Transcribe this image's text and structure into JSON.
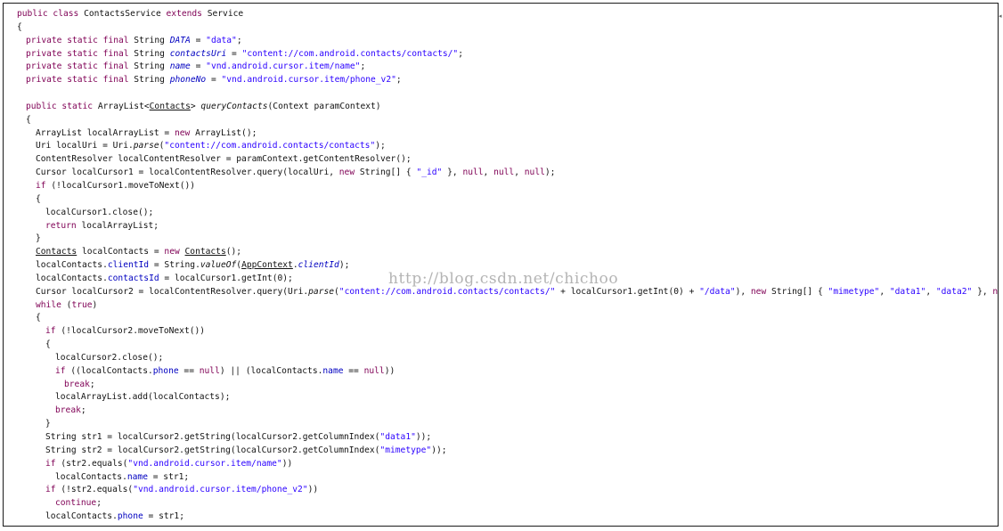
{
  "watermark": "http://blog.csdn.net/chichoo",
  "scroll_marker": "◂",
  "colors": {
    "keyword": "#7f0055",
    "string": "#2a00ff",
    "field": "#0000c0",
    "text": "#111111"
  },
  "lines": [
    {
      "indent": 0,
      "tokens": [
        {
          "t": "public class ",
          "c": "kw"
        },
        {
          "t": "ContactsService "
        },
        {
          "t": "extends ",
          "c": "kw"
        },
        {
          "t": "Service"
        }
      ]
    },
    {
      "indent": 0,
      "tokens": [
        {
          "t": "{"
        }
      ]
    },
    {
      "indent": 1,
      "tokens": [
        {
          "t": "private static final ",
          "c": "kw"
        },
        {
          "t": "String "
        },
        {
          "t": "DATA",
          "c": "fld it"
        },
        {
          "t": " = "
        },
        {
          "t": "\"data\"",
          "c": "st"
        },
        {
          "t": ";"
        }
      ]
    },
    {
      "indent": 1,
      "tokens": [
        {
          "t": "private static final ",
          "c": "kw"
        },
        {
          "t": "String "
        },
        {
          "t": "contactsUri",
          "c": "fld it"
        },
        {
          "t": " = "
        },
        {
          "t": "\"content://com.android.contacts/contacts/\"",
          "c": "st"
        },
        {
          "t": ";"
        }
      ]
    },
    {
      "indent": 1,
      "tokens": [
        {
          "t": "private static final ",
          "c": "kw"
        },
        {
          "t": "String "
        },
        {
          "t": "name",
          "c": "fld it"
        },
        {
          "t": " = "
        },
        {
          "t": "\"vnd.android.cursor.item/name\"",
          "c": "st"
        },
        {
          "t": ";"
        }
      ]
    },
    {
      "indent": 1,
      "tokens": [
        {
          "t": "private static final ",
          "c": "kw"
        },
        {
          "t": "String "
        },
        {
          "t": "phoneNo",
          "c": "fld it"
        },
        {
          "t": " = "
        },
        {
          "t": "\"vnd.android.cursor.item/phone_v2\"",
          "c": "st"
        },
        {
          "t": ";"
        }
      ]
    },
    {
      "indent": 0,
      "tokens": []
    },
    {
      "indent": 1,
      "tokens": [
        {
          "t": "public static ",
          "c": "kw"
        },
        {
          "t": "ArrayList<"
        },
        {
          "t": "Contacts",
          "c": "u"
        },
        {
          "t": "> "
        },
        {
          "t": "queryContacts",
          "c": "it"
        },
        {
          "t": "(Context paramContext)"
        }
      ]
    },
    {
      "indent": 1,
      "tokens": [
        {
          "t": "{"
        }
      ]
    },
    {
      "indent": 2,
      "tokens": [
        {
          "t": "ArrayList localArrayList = "
        },
        {
          "t": "new ",
          "c": "kw"
        },
        {
          "t": "ArrayList();"
        }
      ]
    },
    {
      "indent": 2,
      "tokens": [
        {
          "t": "Uri localUri = Uri."
        },
        {
          "t": "parse",
          "c": "it"
        },
        {
          "t": "("
        },
        {
          "t": "\"content://com.android.contacts/contacts\"",
          "c": "st"
        },
        {
          "t": ");"
        }
      ]
    },
    {
      "indent": 2,
      "tokens": [
        {
          "t": "ContentResolver localContentResolver = paramContext.getContentResolver();"
        }
      ]
    },
    {
      "indent": 2,
      "tokens": [
        {
          "t": "Cursor localCursor1 = localContentResolver.query(localUri, "
        },
        {
          "t": "new ",
          "c": "kw"
        },
        {
          "t": "String[] { "
        },
        {
          "t": "\"_id\"",
          "c": "st"
        },
        {
          "t": " }, "
        },
        {
          "t": "null",
          "c": "kw"
        },
        {
          "t": ", "
        },
        {
          "t": "null",
          "c": "kw"
        },
        {
          "t": ", "
        },
        {
          "t": "null",
          "c": "kw"
        },
        {
          "t": ");"
        }
      ]
    },
    {
      "indent": 2,
      "tokens": [
        {
          "t": "if ",
          "c": "kw"
        },
        {
          "t": "(!localCursor1.moveToNext())"
        }
      ]
    },
    {
      "indent": 2,
      "tokens": [
        {
          "t": "{"
        }
      ]
    },
    {
      "indent": 3,
      "tokens": [
        {
          "t": "localCursor1.close();"
        }
      ]
    },
    {
      "indent": 3,
      "tokens": [
        {
          "t": "return ",
          "c": "kw"
        },
        {
          "t": "localArrayList;"
        }
      ]
    },
    {
      "indent": 2,
      "tokens": [
        {
          "t": "}"
        }
      ]
    },
    {
      "indent": 2,
      "tokens": [
        {
          "t": "Contacts",
          "c": "u"
        },
        {
          "t": " localContacts = "
        },
        {
          "t": "new ",
          "c": "kw"
        },
        {
          "t": "Contacts",
          "c": "u"
        },
        {
          "t": "();"
        }
      ]
    },
    {
      "indent": 2,
      "tokens": [
        {
          "t": "localContacts."
        },
        {
          "t": "clientId",
          "c": "fld"
        },
        {
          "t": " = String."
        },
        {
          "t": "valueOf",
          "c": "it"
        },
        {
          "t": "("
        },
        {
          "t": "AppContext",
          "c": "u"
        },
        {
          "t": "."
        },
        {
          "t": "clientId",
          "c": "fld it"
        },
        {
          "t": ");"
        }
      ]
    },
    {
      "indent": 2,
      "tokens": [
        {
          "t": "localContacts."
        },
        {
          "t": "contactsId",
          "c": "fld"
        },
        {
          "t": " = localCursor1.getInt(0);"
        }
      ]
    },
    {
      "indent": 2,
      "tokens": [
        {
          "t": "Cursor localCursor2 = localContentResolver.query(Uri."
        },
        {
          "t": "parse",
          "c": "it"
        },
        {
          "t": "("
        },
        {
          "t": "\"content://com.android.contacts/contacts/\"",
          "c": "st"
        },
        {
          "t": " + localCursor1.getInt(0) + "
        },
        {
          "t": "\"/data\"",
          "c": "st"
        },
        {
          "t": "), "
        },
        {
          "t": "new ",
          "c": "kw"
        },
        {
          "t": "String[] { "
        },
        {
          "t": "\"mimetype\"",
          "c": "st"
        },
        {
          "t": ", "
        },
        {
          "t": "\"data1\"",
          "c": "st"
        },
        {
          "t": ", "
        },
        {
          "t": "\"data2\"",
          "c": "st"
        },
        {
          "t": " }, "
        },
        {
          "t": "null",
          "c": "kw"
        },
        {
          "t": ", "
        },
        {
          "t": "null",
          "c": "kw"
        },
        {
          "t": ", "
        },
        {
          "t": "null",
          "c": "kw"
        },
        {
          "t": ");"
        }
      ]
    },
    {
      "indent": 2,
      "tokens": [
        {
          "t": "while ",
          "c": "kw"
        },
        {
          "t": "("
        },
        {
          "t": "true",
          "c": "kw"
        },
        {
          "t": ")"
        }
      ]
    },
    {
      "indent": 2,
      "tokens": [
        {
          "t": "{"
        }
      ]
    },
    {
      "indent": 3,
      "tokens": [
        {
          "t": "if ",
          "c": "kw"
        },
        {
          "t": "(!localCursor2.moveToNext())"
        }
      ]
    },
    {
      "indent": 3,
      "tokens": [
        {
          "t": "{"
        }
      ]
    },
    {
      "indent": 4,
      "tokens": [
        {
          "t": "localCursor2.close();"
        }
      ]
    },
    {
      "indent": 4,
      "tokens": [
        {
          "t": "if ",
          "c": "kw"
        },
        {
          "t": "((localContacts."
        },
        {
          "t": "phone",
          "c": "fld"
        },
        {
          "t": " == "
        },
        {
          "t": "null",
          "c": "kw"
        },
        {
          "t": ") || (localContacts."
        },
        {
          "t": "name",
          "c": "fld"
        },
        {
          "t": " == "
        },
        {
          "t": "null",
          "c": "kw"
        },
        {
          "t": "))"
        }
      ]
    },
    {
      "indent": 5,
      "tokens": [
        {
          "t": "break",
          "c": "kw"
        },
        {
          "t": ";"
        }
      ]
    },
    {
      "indent": 4,
      "tokens": [
        {
          "t": "localArrayList.add(localContacts);"
        }
      ]
    },
    {
      "indent": 4,
      "tokens": [
        {
          "t": "break",
          "c": "kw"
        },
        {
          "t": ";"
        }
      ]
    },
    {
      "indent": 3,
      "tokens": [
        {
          "t": "}"
        }
      ]
    },
    {
      "indent": 3,
      "tokens": [
        {
          "t": "String str1 = localCursor2.getString(localCursor2.getColumnIndex("
        },
        {
          "t": "\"data1\"",
          "c": "st"
        },
        {
          "t": "));"
        }
      ]
    },
    {
      "indent": 3,
      "tokens": [
        {
          "t": "String str2 = localCursor2.getString(localCursor2.getColumnIndex("
        },
        {
          "t": "\"mimetype\"",
          "c": "st"
        },
        {
          "t": "));"
        }
      ]
    },
    {
      "indent": 3,
      "tokens": [
        {
          "t": "if ",
          "c": "kw"
        },
        {
          "t": "(str2.equals("
        },
        {
          "t": "\"vnd.android.cursor.item/name\"",
          "c": "st"
        },
        {
          "t": "))"
        }
      ]
    },
    {
      "indent": 4,
      "tokens": [
        {
          "t": "localContacts."
        },
        {
          "t": "name",
          "c": "fld"
        },
        {
          "t": " = str1;"
        }
      ]
    },
    {
      "indent": 3,
      "tokens": [
        {
          "t": "if ",
          "c": "kw"
        },
        {
          "t": "(!str2.equals("
        },
        {
          "t": "\"vnd.android.cursor.item/phone_v2\"",
          "c": "st"
        },
        {
          "t": "))"
        }
      ]
    },
    {
      "indent": 4,
      "tokens": [
        {
          "t": "continue",
          "c": "kw"
        },
        {
          "t": ";"
        }
      ]
    },
    {
      "indent": 3,
      "tokens": [
        {
          "t": "localContacts."
        },
        {
          "t": "phone",
          "c": "fld"
        },
        {
          "t": " = str1;"
        }
      ]
    }
  ]
}
